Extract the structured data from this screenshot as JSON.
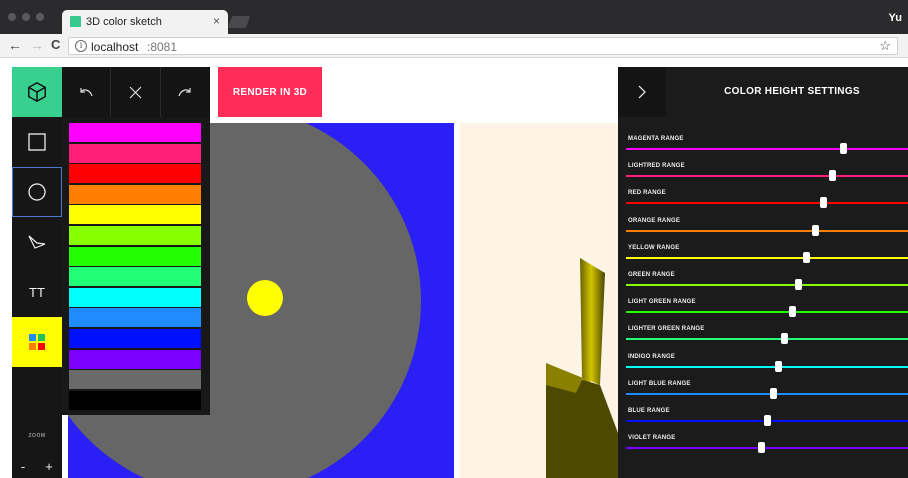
{
  "browser": {
    "tab_title": "3D color sketch",
    "tab_close": "×",
    "profile": "Yu",
    "back": "←",
    "forward": "→",
    "reload": "C",
    "info": "i",
    "url_host": "localhost",
    "url_port": ":8081",
    "star": "☆"
  },
  "toolbar": {
    "render_label": "RENDER IN 3D",
    "zoom_label": "ZOOM",
    "zoom_out": "-",
    "zoom_in": "+"
  },
  "tools": {
    "text_tool_label": "TT"
  },
  "palette": {
    "colors": [
      "#ff00ff",
      "#ff1e78",
      "#ff0000",
      "#ff8000",
      "#ffff00",
      "#88ff00",
      "#22ff00",
      "#22ff77",
      "#00ffff",
      "#1e8cff",
      "#0010ff",
      "#7b00ff",
      "#6a6a6a",
      "#000000"
    ]
  },
  "settings": {
    "title": "COLOR HEIGHT SETTINGS",
    "ranges": [
      {
        "label": "MAGENTA RANGE",
        "color": "#ff00ff",
        "value": 0.77
      },
      {
        "label": "LIGHTRED RANGE",
        "color": "#ff1e78",
        "value": 0.73
      },
      {
        "label": "RED RANGE",
        "color": "#ff0000",
        "value": 0.7
      },
      {
        "label": "ORANGE RANGE",
        "color": "#ff8000",
        "value": 0.67
      },
      {
        "label": "YELLOW RANGE",
        "color": "#ffff00",
        "value": 0.64
      },
      {
        "label": "GREEN RANGE",
        "color": "#88ff00",
        "value": 0.61
      },
      {
        "label": "LIGHT GREEN RANGE",
        "color": "#22ff00",
        "value": 0.59
      },
      {
        "label": "LIGHTER GREEN RANGE",
        "color": "#22ff77",
        "value": 0.56
      },
      {
        "label": "INDIGO RANGE",
        "color": "#00ffff",
        "value": 0.54
      },
      {
        "label": "LIGHT BLUE RANGE",
        "color": "#1e8cff",
        "value": 0.52
      },
      {
        "label": "BLUE RANGE",
        "color": "#0010ff",
        "value": 0.5
      },
      {
        "label": "VIOLET RANGE",
        "color": "#7b00ff",
        "value": 0.48
      }
    ]
  },
  "canvas": {
    "background": "#2a1ff5",
    "circle_color": "#666666",
    "dot_color": "#ffff00"
  },
  "colors": {
    "accent": "#ff2c5a",
    "brand": "#38d08f",
    "active_tool": "#ffff00"
  }
}
